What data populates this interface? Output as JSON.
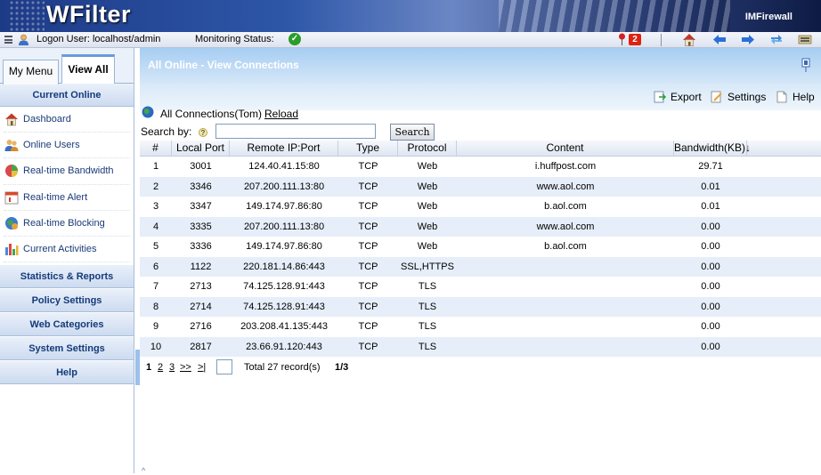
{
  "header": {
    "logo": "WFilter",
    "brand": "IMFirewall"
  },
  "status": {
    "logon": "Logon User: localhost/admin",
    "monitoring_label": "Monitoring Status:",
    "alert_count": "2"
  },
  "sidebar": {
    "tabs": [
      "My Menu",
      "View All"
    ],
    "current_section": "Current Online",
    "items": [
      {
        "label": "Dashboard",
        "icon": "house-icon"
      },
      {
        "label": "Online Users",
        "icon": "users-icon"
      },
      {
        "label": "Real-time Bandwidth",
        "icon": "pie-chart-icon"
      },
      {
        "label": "Real-time Alert",
        "icon": "calendar-alert-icon"
      },
      {
        "label": "Real-time Blocking",
        "icon": "globe-block-icon"
      },
      {
        "label": "Current Activities",
        "icon": "bar-chart-icon"
      }
    ],
    "sections": [
      "Statistics & Reports",
      "Policy Settings",
      "Web Categories",
      "System Settings",
      "Help"
    ]
  },
  "main": {
    "title": "All Online - View Connections",
    "toolbar": {
      "export": "Export",
      "settings": "Settings",
      "help": "Help"
    },
    "connections_label": "All Connections(Tom)",
    "reload": "Reload",
    "search_label": "Search by:",
    "search_value": "",
    "search_button": "Search"
  },
  "table": {
    "columns": [
      "#",
      "Local Port",
      "Remote IP:Port",
      "Type",
      "Protocol",
      "Content",
      "Bandwidth(KB)↓"
    ],
    "rows": [
      [
        "1",
        "3001",
        "124.40.41.15:80",
        "TCP",
        "Web",
        "i.huffpost.com",
        "29.71"
      ],
      [
        "2",
        "3346",
        "207.200.111.13:80",
        "TCP",
        "Web",
        "www.aol.com",
        "0.01"
      ],
      [
        "3",
        "3347",
        "149.174.97.86:80",
        "TCP",
        "Web",
        "b.aol.com",
        "0.01"
      ],
      [
        "4",
        "3335",
        "207.200.111.13:80",
        "TCP",
        "Web",
        "www.aol.com",
        "0.00"
      ],
      [
        "5",
        "3336",
        "149.174.97.86:80",
        "TCP",
        "Web",
        "b.aol.com",
        "0.00"
      ],
      [
        "6",
        "1122",
        "220.181.14.86:443",
        "TCP",
        "SSL,HTTPS",
        "",
        "0.00"
      ],
      [
        "7",
        "2713",
        "74.125.128.91:443",
        "TCP",
        "TLS",
        "",
        "0.00"
      ],
      [
        "8",
        "2714",
        "74.125.128.91:443",
        "TCP",
        "TLS",
        "",
        "0.00"
      ],
      [
        "9",
        "2716",
        "203.208.41.135:443",
        "TCP",
        "TLS",
        "",
        "0.00"
      ],
      [
        "10",
        "2817",
        "23.66.91.120:443",
        "TCP",
        "TLS",
        "",
        "0.00"
      ]
    ]
  },
  "pager": {
    "pages": [
      "1",
      "2",
      "3",
      ">>",
      ">|"
    ],
    "total": "Total 27 record(s)",
    "position": "1/3"
  }
}
